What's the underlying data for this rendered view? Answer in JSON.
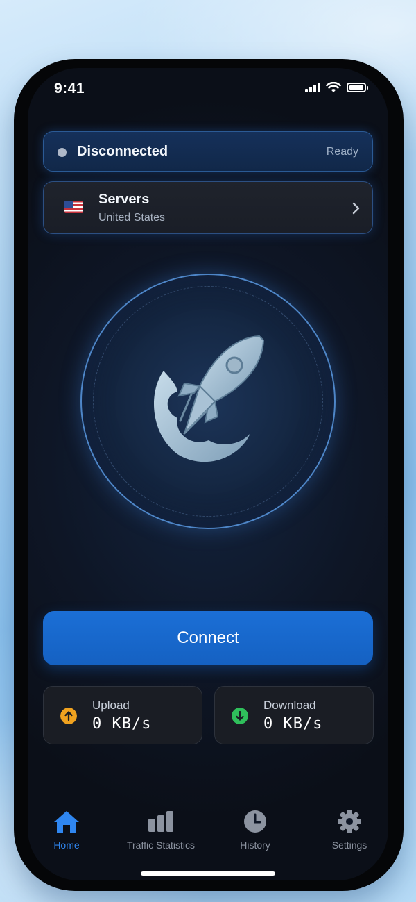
{
  "status_bar": {
    "time": "9:41"
  },
  "connection": {
    "status": "Disconnected",
    "state_label": "Ready"
  },
  "server": {
    "title": "Servers",
    "country": "United States",
    "flag": "us-flag-icon"
  },
  "orb": {
    "icon": "rocket-icon"
  },
  "connect_button": {
    "label": "Connect"
  },
  "stats": {
    "upload": {
      "label": "Upload",
      "value": "0 KB/s",
      "icon": "arrow-up-icon",
      "color": "#f0a21f"
    },
    "download": {
      "label": "Download",
      "value": "0 KB/s",
      "icon": "arrow-down-icon",
      "color": "#2fbf5b"
    }
  },
  "tabs": [
    {
      "label": "Home",
      "icon": "home-icon",
      "active": true
    },
    {
      "label": "Traffic Statistics",
      "icon": "bar-chart-icon",
      "active": false
    },
    {
      "label": "History",
      "icon": "clock-icon",
      "active": false
    },
    {
      "label": "Settings",
      "icon": "gear-icon",
      "active": false
    }
  ],
  "colors": {
    "accent": "#1b6fd6",
    "active_tab": "#2f86f0",
    "inactive_tab": "#8c93a0",
    "screen_bg": "#0e1626"
  }
}
